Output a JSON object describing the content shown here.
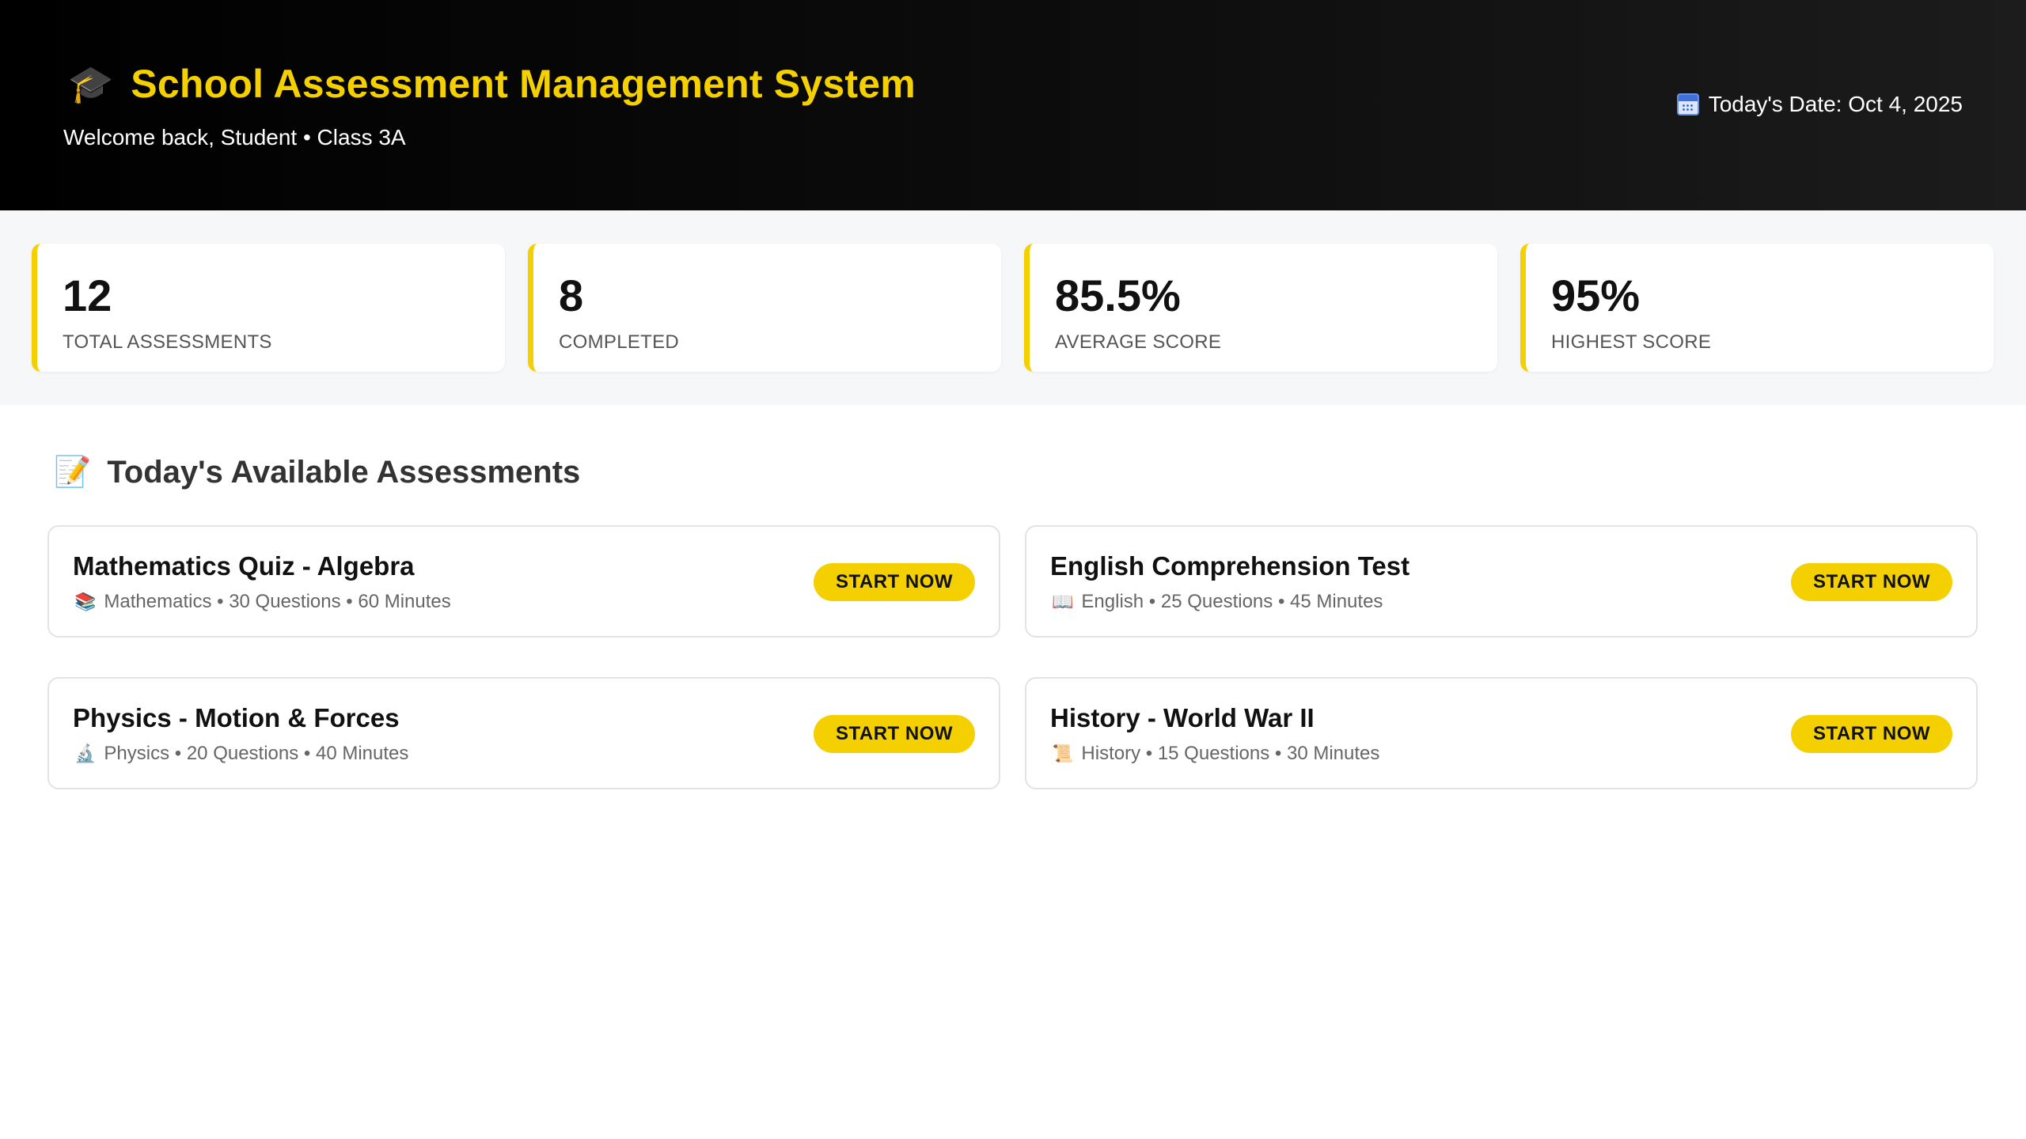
{
  "header": {
    "icon": "graduation-cap-icon",
    "title_emoji": "🎓",
    "title": "School Assessment Management System",
    "subtitle": "Welcome back, Student • Class 3A",
    "date_icon": "calendar-icon",
    "date": "Today's Date: Oct 4, 2025",
    "accent_color": "#f5d000"
  },
  "stats": [
    {
      "value": "12",
      "label": "TOTAL ASSESSMENTS"
    },
    {
      "value": "8",
      "label": "COMPLETED"
    },
    {
      "value": "85.5%",
      "label": "AVERAGE SCORE"
    },
    {
      "value": "95%",
      "label": "HIGHEST SCORE"
    }
  ],
  "section": {
    "icon": "memo-icon",
    "emoji": "📝",
    "title": "Today's Available Assessments"
  },
  "assessments": [
    {
      "name": "Mathematics Quiz - Algebra",
      "icon": "books-icon",
      "emoji": "📚",
      "meta": "Mathematics • 30 Questions • 60 Minutes",
      "button": "START NOW"
    },
    {
      "name": "English Comprehension Test",
      "icon": "open-book-icon",
      "emoji": "📖",
      "meta": "English • 25 Questions • 45 Minutes",
      "button": "START NOW"
    },
    {
      "name": "Physics - Motion & Forces",
      "icon": "microscope-icon",
      "emoji": "🔬",
      "meta": "Physics • 20 Questions • 40 Minutes",
      "button": "START NOW"
    },
    {
      "name": "History - World War II",
      "icon": "scroll-icon",
      "emoji": "📜",
      "meta": "History • 15 Questions • 30 Minutes",
      "button": "START NOW"
    }
  ]
}
